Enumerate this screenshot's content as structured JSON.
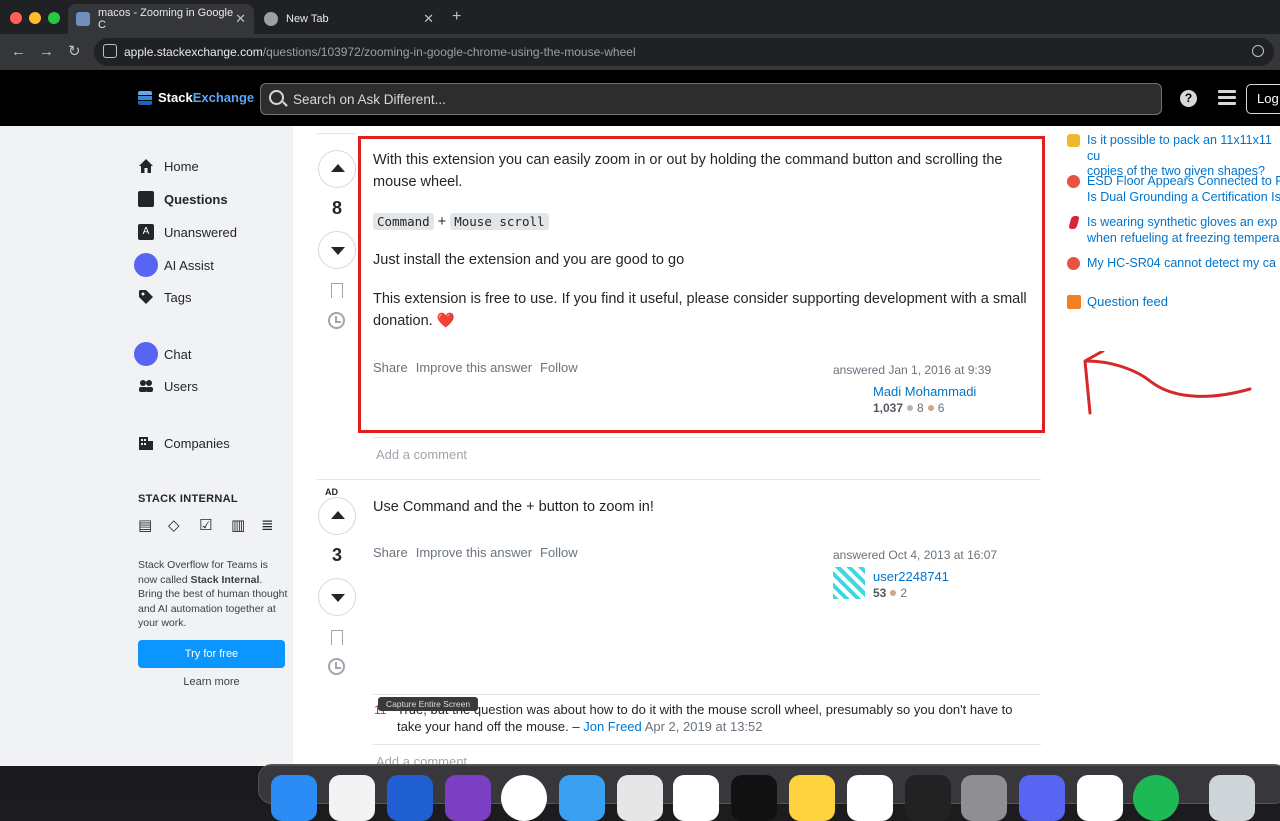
{
  "browser": {
    "tabs": [
      {
        "title": "macos - Zooming in Google C",
        "active": true
      },
      {
        "title": "New Tab",
        "active": false
      }
    ],
    "new_tab_glyph": "+",
    "url_host": "apple.stackexchange.com",
    "url_path": "/questions/103972/zooming-in-google-chrome-using-the-mouse-wheel"
  },
  "header": {
    "logo_part1": "Stack",
    "logo_part2": "Exchange",
    "search_placeholder": "Search on Ask Different...",
    "help_glyph": "?",
    "login_label": "Log"
  },
  "sidebar": {
    "items": [
      {
        "label": "Home",
        "icon": "home-icon"
      },
      {
        "label": "Questions",
        "icon": "questions-icon"
      },
      {
        "label": "Unanswered",
        "icon": "unanswered-icon"
      },
      {
        "label": "AI Assist",
        "icon": "ai-assist-icon"
      },
      {
        "label": "Tags",
        "icon": "tag-icon"
      },
      {
        "label": "Chat",
        "icon": "chat-icon"
      },
      {
        "label": "Users",
        "icon": "users-icon"
      },
      {
        "label": "Companies",
        "icon": "companies-icon"
      }
    ],
    "stack_internal": {
      "title": "STACK INTERNAL",
      "text_before": "Stack Overflow for Teams is now called ",
      "text_bold": "Stack Internal",
      "text_after": ". Bring the best of human thought and AI automation together at your work.",
      "try_label": "Try for free",
      "learn_label": "Learn more"
    }
  },
  "answers": [
    {
      "votes": "8",
      "para1": "With this extension you can easily zoom in or out by holding the command button and scrolling the mouse wheel.",
      "key1": "Command",
      "plus": "+",
      "key2": "Mouse scroll",
      "para2": "Just install the extension and you are good to go",
      "para3": "This extension is free to use. If you find it useful, please consider supporting development with a small donation.",
      "heart": "❤️",
      "menu": [
        "Share",
        "Improve this answer",
        "Follow"
      ],
      "answered": "answered Jan 1, 2016 at 9:39",
      "user": "Madi Mohammadi",
      "rep": "1,037",
      "silver": "8",
      "bronze": "6",
      "add_comment": "Add a comment"
    },
    {
      "ad_label": "AD",
      "votes": "3",
      "text": "Use Command and the + button to zoom in!",
      "menu": [
        "Share",
        "Improve this answer",
        "Follow"
      ],
      "answered": "answered Oct 4, 2013 at 16:07",
      "user": "user2248741",
      "rep": "53",
      "bronze": "2",
      "comment": {
        "score": "11",
        "text": "True, but the question was about how to do it with the mouse scroll wheel, presumably so you don't have to take your hand off the mouse. –",
        "author": "Jon Freed",
        "date": "Apr 2, 2019 at 13:52"
      },
      "add_comment": "Add a comment"
    }
  ],
  "hot_questions": [
    {
      "line1": "Is it possible to pack an 11x11x11 cu",
      "line2": "copies of the two given shapes?",
      "color": "#f2b630"
    },
    {
      "line1": "ESD Floor Appears Connected to P",
      "line2": "Is Dual Grounding a Certification Is",
      "color": "#e8523f"
    },
    {
      "line1": "Is wearing synthetic gloves an exp",
      "line2": "when refueling at freezing tempera",
      "color": "#d8253a"
    },
    {
      "line1": "My HC-SR04 cannot detect my ca",
      "line2": "",
      "color": "#e8523f"
    }
  ],
  "question_feed": "Question feed",
  "tooltip": "Capture Entire Screen",
  "colors": {
    "accent": "#0a95ff",
    "link": "#0074cc",
    "highlight": "#e02020"
  }
}
